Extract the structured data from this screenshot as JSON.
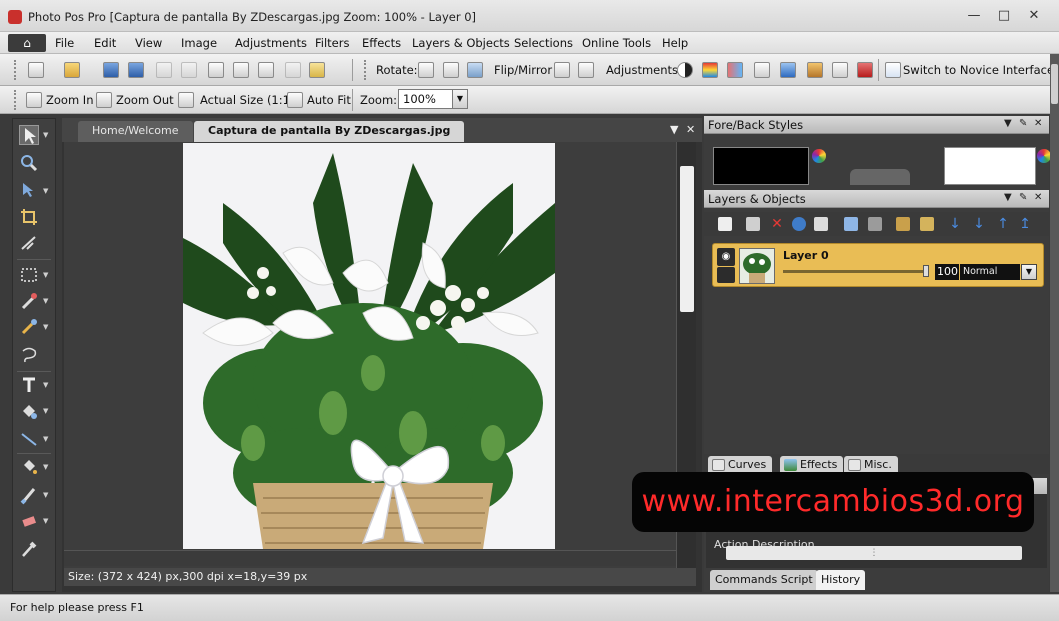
{
  "window": {
    "title": "Photo Pos Pro [Captura de pantalla By ZDescargas.jpg Zoom: 100% - Layer 0]",
    "minimize": "—",
    "maximize": "□",
    "close": "✕"
  },
  "menu": {
    "home_icon": "home-icon",
    "items": [
      "File",
      "Edit",
      "View",
      "Image",
      "Adjustments",
      "Filters",
      "Effects",
      "Layers & Objects",
      "Selections",
      "Online Tools",
      "Help"
    ]
  },
  "toolbar1": {
    "rotate_label": "Rotate:",
    "flip_label": "Flip/Mirror",
    "adjustments_label": "Adjustments:",
    "novice_label": "Switch to Novice Interface"
  },
  "toolbar2": {
    "zoom_in": "Zoom In",
    "zoom_out": "Zoom Out",
    "actual_size": "Actual Size (1:1)",
    "auto_fit": "Auto Fit",
    "zoom_label": "Zoom:",
    "zoom_value": "100%"
  },
  "document": {
    "tabs": [
      {
        "label": "Home/Welcome",
        "active": false
      },
      {
        "label": "Captura de pantalla By ZDescargas.jpg",
        "active": true
      }
    ],
    "status": "Size: (372 x 424) px,300 dpi   x=18,y=39 px"
  },
  "panels": {
    "fore_back": {
      "title": "Fore/Back Styles",
      "fore_color": "#000000",
      "back_color": "#ffffff"
    },
    "layers": {
      "title": "Layers & Objects",
      "layer": {
        "name": "Layer 0",
        "opacity": "100",
        "opacity_fraction": 1.0,
        "blend_mode": "Normal"
      }
    },
    "tabs": [
      "Curves",
      "Effects",
      "Misc."
    ],
    "bottom_label": "Action Description",
    "bottom_tabs": [
      {
        "label": "Commands Script",
        "active": false
      },
      {
        "label": "History",
        "active": true
      }
    ]
  },
  "statusbar": {
    "text": "For help please press F1"
  },
  "watermark": {
    "text": "www.intercambios3d.org",
    "color": "#ff2a2a"
  }
}
